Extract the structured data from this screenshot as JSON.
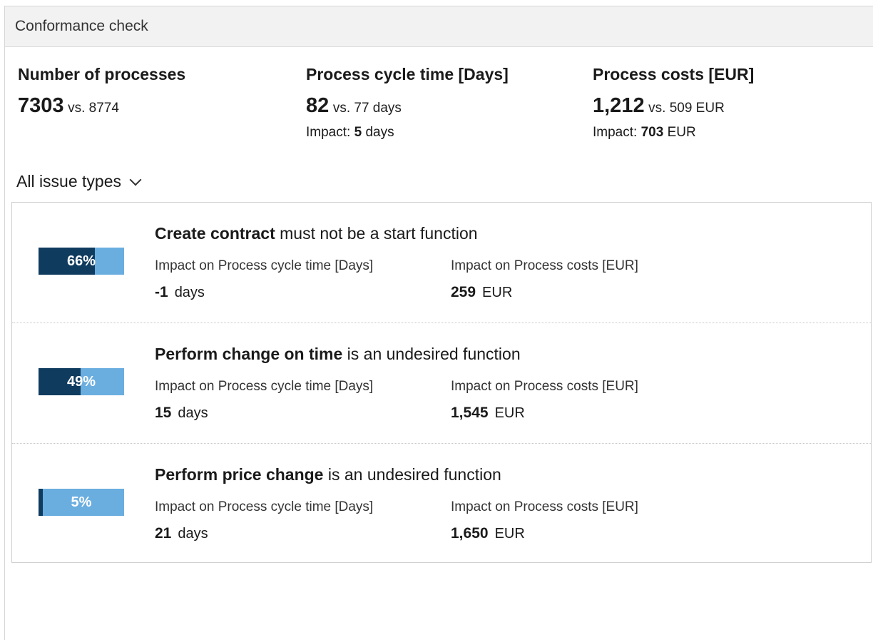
{
  "header": {
    "title": "Conformance check"
  },
  "kpis": [
    {
      "title": "Number of processes",
      "value": "7303",
      "vs": "vs. 8774",
      "impact_label": "",
      "impact_value": "",
      "impact_unit": ""
    },
    {
      "title": "Process cycle time [Days]",
      "value": "82",
      "vs": "vs. 77 days",
      "impact_label": "Impact:",
      "impact_value": "5",
      "impact_unit": "days"
    },
    {
      "title": "Process costs [EUR]",
      "value": "1,212",
      "vs": "vs. 509 EUR",
      "impact_label": "Impact:",
      "impact_value": "703",
      "impact_unit": "EUR"
    }
  ],
  "filter": {
    "label": "All issue types"
  },
  "issues": [
    {
      "percent": 66,
      "percent_label": "66%",
      "title_bold": "Create contract",
      "title_rest": " must not be a start function",
      "cycle_label": "Impact on Process cycle time [Days]",
      "cycle_value": "-1",
      "cycle_unit": "days",
      "cost_label": "Impact on Process costs [EUR]",
      "cost_value": "259",
      "cost_unit": "EUR"
    },
    {
      "percent": 49,
      "percent_label": "49%",
      "title_bold": "Perform change on time",
      "title_rest": " is an undesired function",
      "cycle_label": "Impact on Process cycle time [Days]",
      "cycle_value": "15",
      "cycle_unit": "days",
      "cost_label": "Impact on Process costs [EUR]",
      "cost_value": "1,545",
      "cost_unit": "EUR"
    },
    {
      "percent": 5,
      "percent_label": "5%",
      "title_bold": "Perform price change",
      "title_rest": " is an undesired function",
      "cycle_label": "Impact on Process cycle time [Days]",
      "cycle_value": "21",
      "cycle_unit": "days",
      "cost_label": "Impact on Process costs [EUR]",
      "cost_value": "1,650",
      "cost_unit": "EUR"
    }
  ],
  "colors": {
    "bar_dark": "#0f3b5f",
    "bar_light": "#6aaee0"
  }
}
